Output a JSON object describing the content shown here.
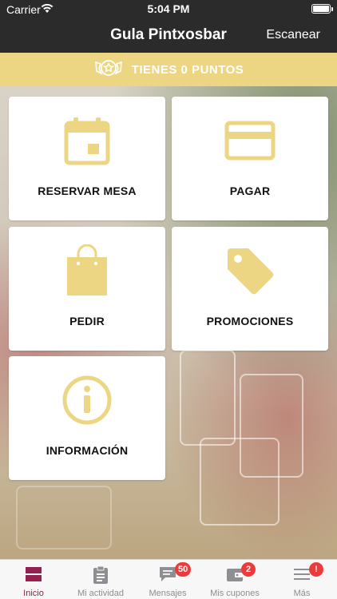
{
  "status_bar": {
    "carrier": "Carrier",
    "time": "5:04 PM"
  },
  "nav": {
    "title": "Gula Pintxosbar",
    "scan_label": "Escanear"
  },
  "points": {
    "text": "TIENES 0 PUNTOS"
  },
  "tiles": [
    {
      "label": "RESERVAR MESA",
      "icon": "calendar-icon"
    },
    {
      "label": "PAGAR",
      "icon": "credit-card-icon"
    },
    {
      "label": "PEDIR",
      "icon": "shopping-bag-icon"
    },
    {
      "label": "PROMOCIONES",
      "icon": "tag-icon"
    },
    {
      "label": "INFORMACIÓN",
      "icon": "info-icon"
    }
  ],
  "tab_bar": {
    "items": [
      {
        "label": "Inicio",
        "icon": "home-grid-icon",
        "active": true
      },
      {
        "label": "Mi actividad",
        "icon": "clipboard-icon"
      },
      {
        "label": "Mensajes",
        "icon": "message-icon",
        "badge": "50"
      },
      {
        "label": "Mis cupones",
        "icon": "wallet-icon",
        "badge": "2"
      },
      {
        "label": "Más",
        "icon": "menu-icon",
        "badge": "!"
      }
    ]
  },
  "colors": {
    "accent_gold": "#ecd684",
    "active_tab": "#93204f",
    "badge_red": "#ec3b3b",
    "dark_bar": "#2b2b2b"
  }
}
